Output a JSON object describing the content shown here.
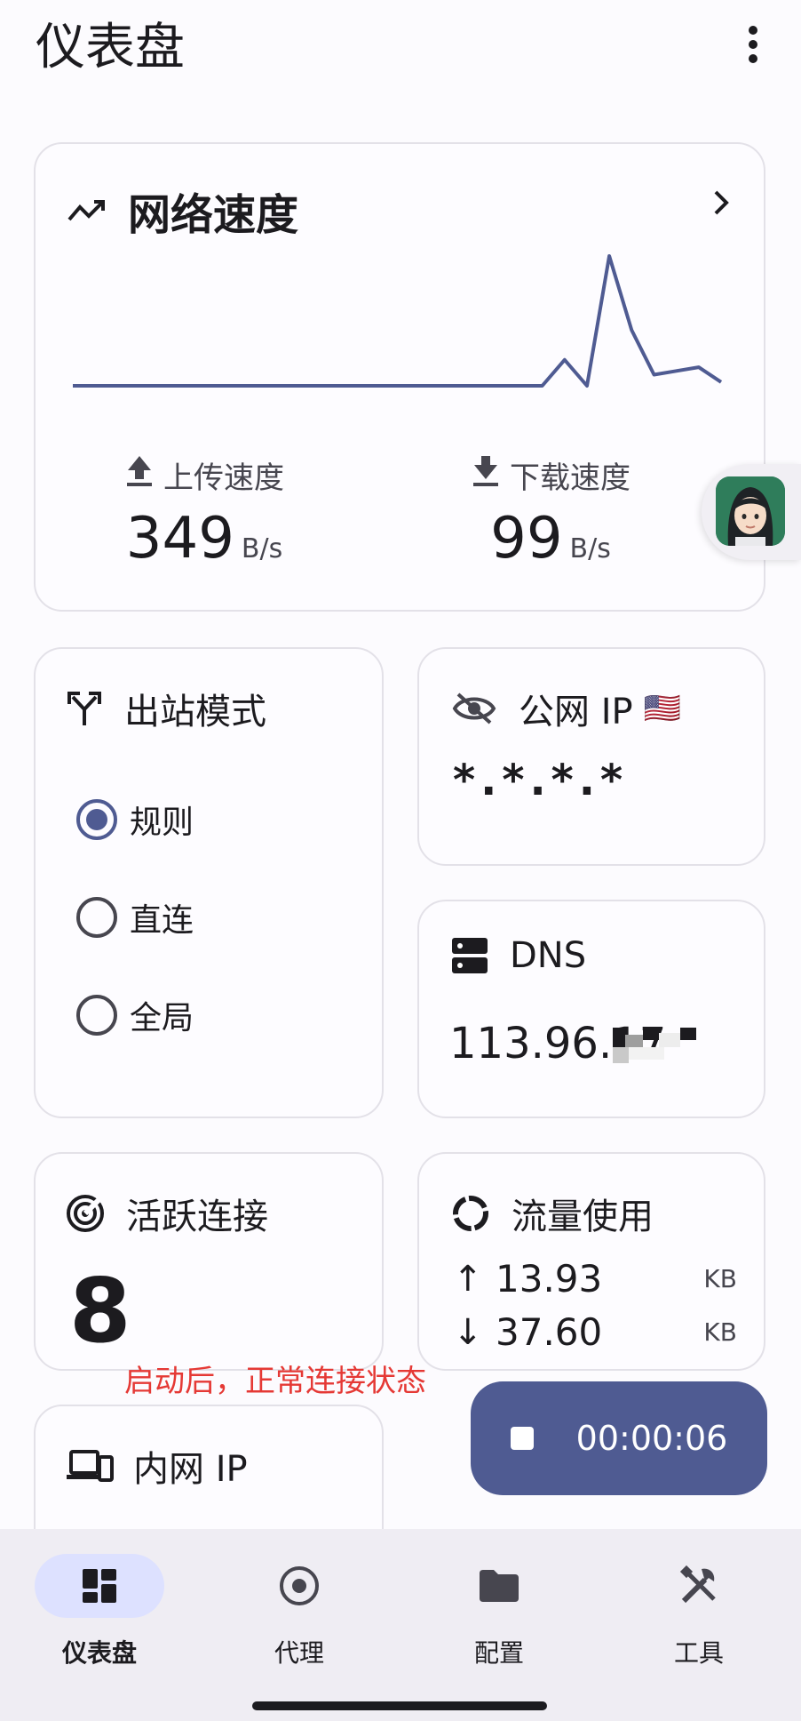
{
  "topbar": {
    "title": "仪表盘",
    "menu_icon": "more-vert-icon"
  },
  "network_speed": {
    "title": "网络速度",
    "icon": "trending-icon",
    "upload": {
      "label": "上传速度",
      "value": "349",
      "unit": "B/s"
    },
    "download": {
      "label": "下载速度",
      "value": "99",
      "unit": "B/s"
    },
    "line_color": "#4f5b92",
    "chart_data": {
      "type": "line",
      "x": [
        0,
        1,
        2,
        3,
        4,
        5,
        6,
        7,
        8,
        9,
        10,
        11,
        12,
        13,
        14,
        15,
        16,
        17,
        18,
        19,
        20,
        21,
        22,
        23,
        24,
        25,
        26,
        27,
        28,
        29
      ],
      "series": [
        {
          "values": [
            0,
            0,
            0,
            0,
            0,
            0,
            0,
            0,
            0,
            0,
            0,
            0,
            0,
            0,
            0,
            0,
            0,
            0,
            0,
            0,
            0,
            0,
            7,
            0,
            35,
            15,
            3,
            4,
            5,
            1
          ]
        }
      ]
    }
  },
  "outbound_mode": {
    "title": "出站模式",
    "icon": "call-split-icon",
    "options": [
      {
        "label": "规则",
        "selected": true
      },
      {
        "label": "直连",
        "selected": false
      },
      {
        "label": "全局",
        "selected": false
      }
    ]
  },
  "public_ip": {
    "title": "公网 IP",
    "flag": "🇺🇸",
    "icon": "visibility-off-icon",
    "value": "*.*.*.*"
  },
  "dns": {
    "title": "DNS",
    "icon": "dns-icon",
    "value": "113.96.17"
  },
  "active_connections": {
    "title": "活跃连接",
    "icon": "radar-icon",
    "value": "8"
  },
  "traffic": {
    "title": "流量使用",
    "icon": "donut-icon",
    "up": {
      "arrow": "↑",
      "value": "13.93",
      "unit": "KB"
    },
    "down": {
      "arrow": "↓",
      "value": "37.60",
      "unit": "KB"
    }
  },
  "annotation": "启动后，正常连接状态",
  "lan_ip": {
    "title": "内网 IP",
    "icon": "devices-icon"
  },
  "timer": {
    "value": "00:00:06",
    "icon": "stop-icon"
  },
  "bottom_nav": [
    {
      "label": "仪表盘",
      "icon": "dashboard-icon",
      "active": true
    },
    {
      "label": "代理",
      "icon": "radio-button-icon",
      "active": false
    },
    {
      "label": "配置",
      "icon": "folder-icon",
      "active": false
    },
    {
      "label": "工具",
      "icon": "tools-icon",
      "active": false
    }
  ]
}
